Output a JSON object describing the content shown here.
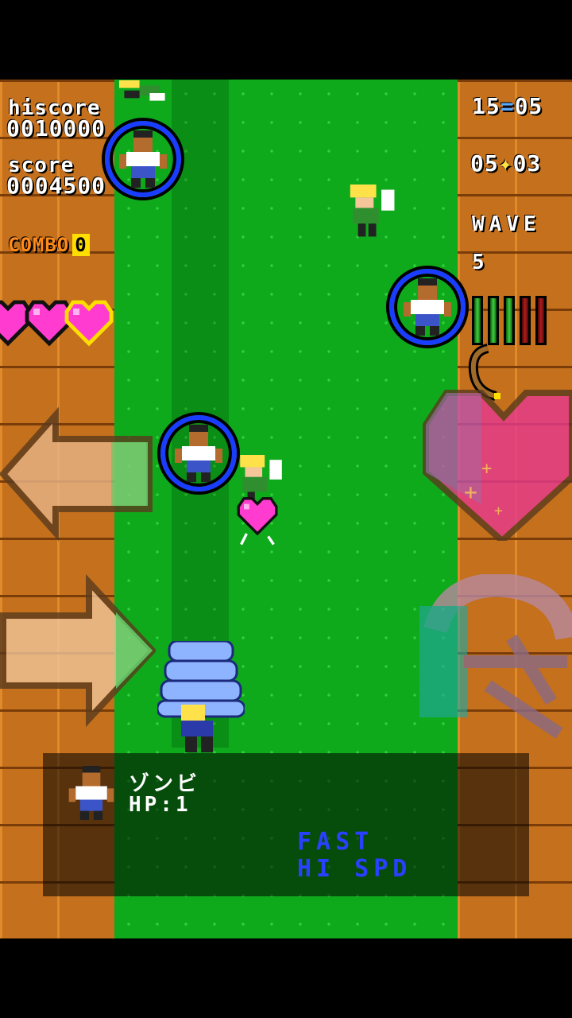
{
  "hud": {
    "hiscore_label": "hiscore",
    "hiscore_value": "0010000",
    "score_label": "score",
    "score_value": "0004500",
    "combo_label": "COMBO",
    "combo_value": "0",
    "lives": 3,
    "time_left": "15",
    "time_right": "05",
    "fairy_left": "05",
    "fairy_right": "03",
    "wave_label": "WAVE",
    "wave_value": "5",
    "power_bars": [
      "green",
      "green",
      "green",
      "red",
      "red"
    ]
  },
  "info_panel": {
    "enemy_name": "ゾンビ",
    "enemy_hp": "HP:1",
    "trait_1": "FAST",
    "trait_2": "HI SPD"
  },
  "colors": {
    "brick": "#c4701c",
    "grass": "#0faa1c",
    "ring": "#1a3cff",
    "heart": "#ff3ccf",
    "combo": "#ff8a1c"
  },
  "controls": [
    "left-arrow-button",
    "right-arrow-button",
    "heart-special-button",
    "hook-button"
  ]
}
